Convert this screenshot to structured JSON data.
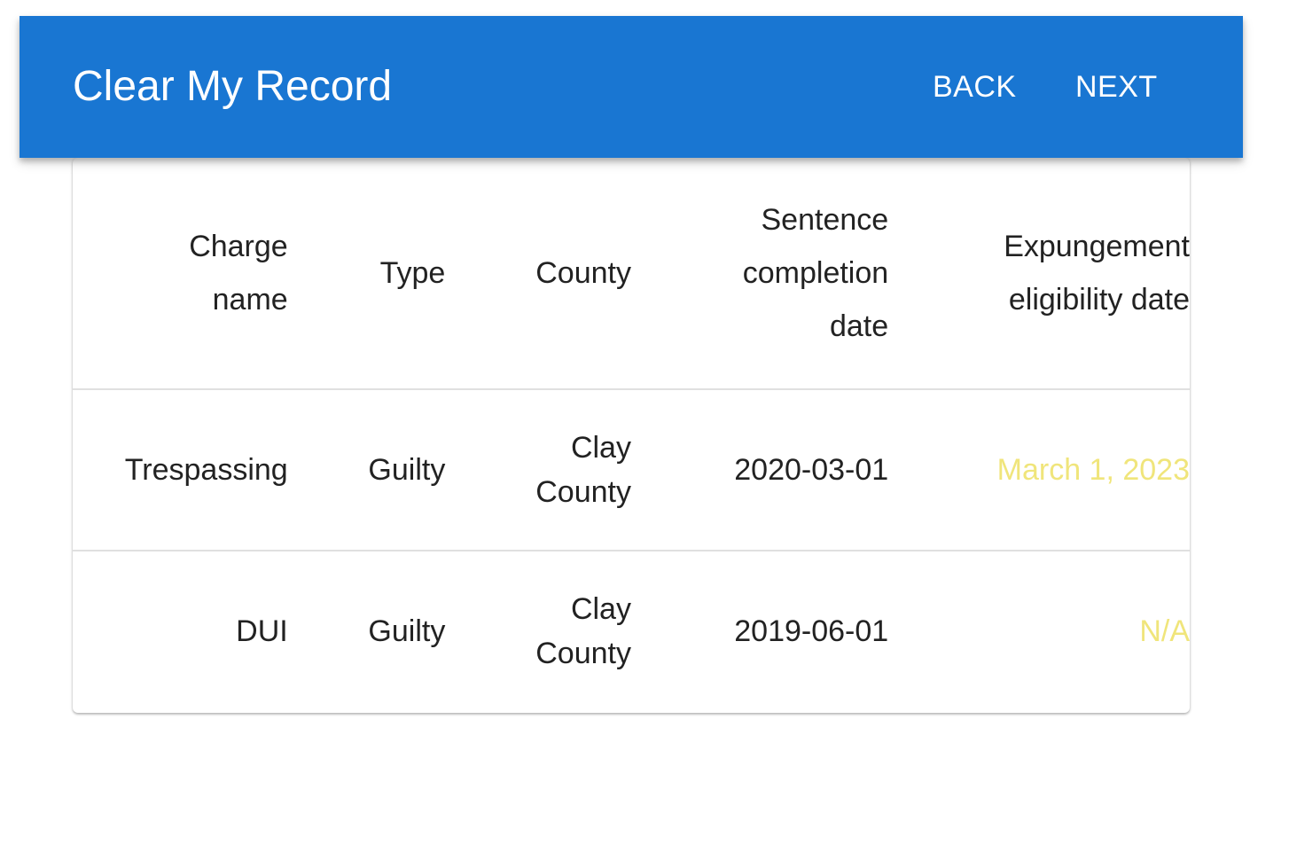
{
  "header": {
    "title": "Clear My Record",
    "back_label": "BACK",
    "next_label": "NEXT"
  },
  "table": {
    "columns": [
      {
        "line1": "Charge",
        "line2": "name"
      },
      {
        "line1": "Type"
      },
      {
        "line1": "County"
      },
      {
        "line1": "Sentence",
        "line2": "completion",
        "line3": "date"
      },
      {
        "line1": "Expungement",
        "line2": "eligibility date"
      }
    ],
    "rows": [
      {
        "charge_name": "Trespassing",
        "type": "Guilty",
        "county_line1": "Clay",
        "county_line2": "County",
        "sentence_completion_date": "2020-03-01",
        "expungement_eligibility_date": "March 1, 2023"
      },
      {
        "charge_name": "DUI",
        "type": "Guilty",
        "county_line1": "Clay",
        "county_line2": "County",
        "sentence_completion_date": "2019-06-01",
        "expungement_eligibility_date": "N/A"
      }
    ]
  },
  "colors": {
    "app_bar": "#1976d2",
    "eligibility_text": "#f0e57b"
  }
}
